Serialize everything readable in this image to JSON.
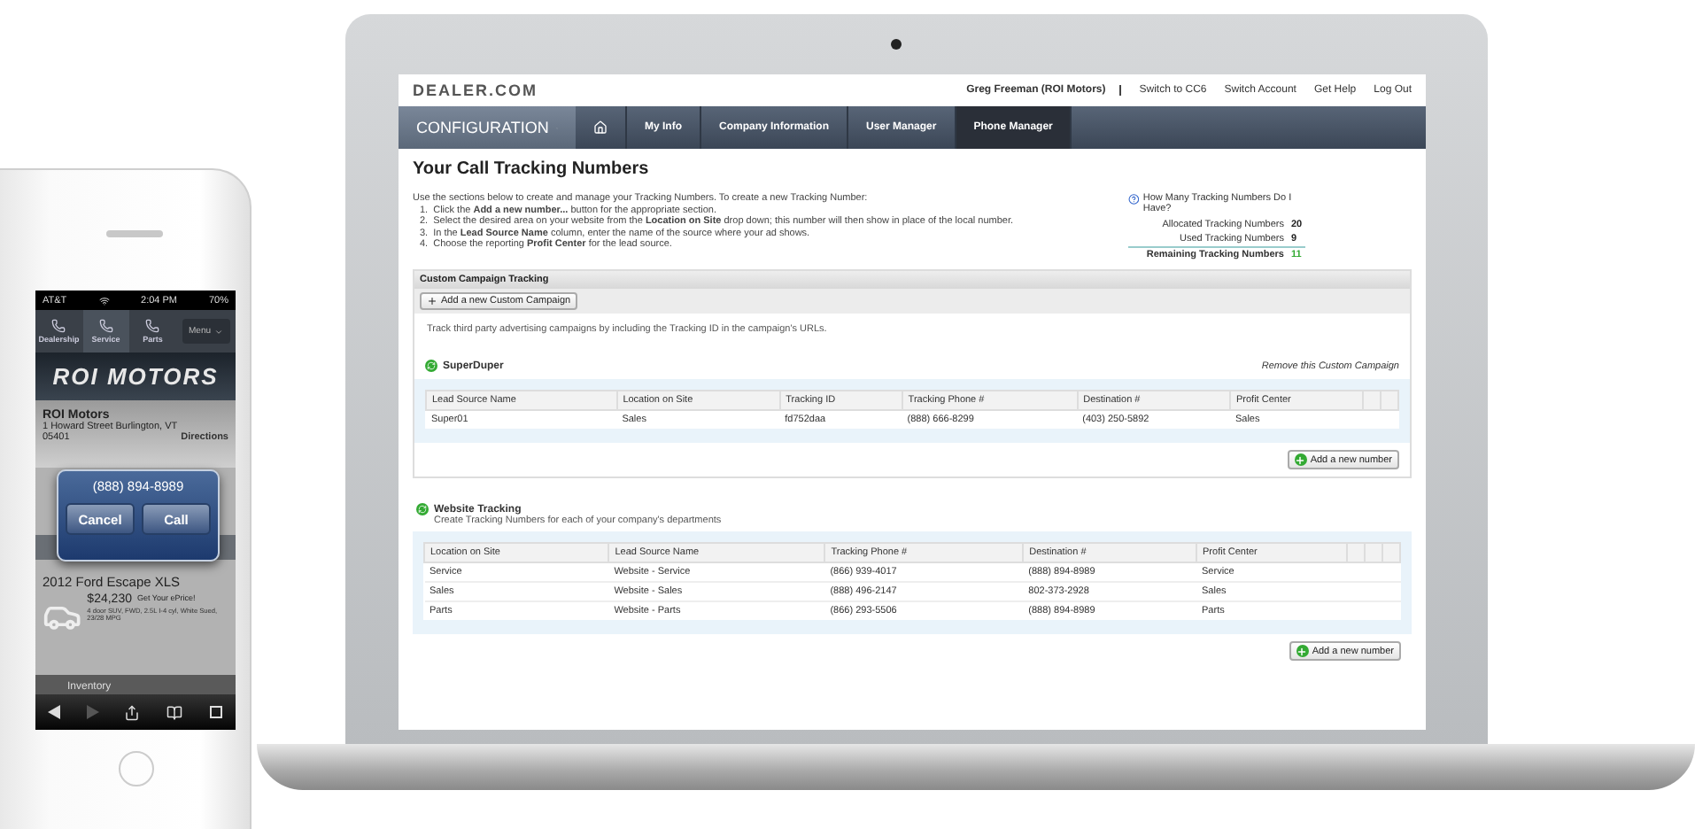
{
  "phone": {
    "status_bar": {
      "carrier": "AT&T",
      "time": "2:04 PM",
      "battery": "70%"
    },
    "nav": [
      {
        "label": "Dealership",
        "selected": false
      },
      {
        "label": "Service",
        "selected": true
      },
      {
        "label": "Parts",
        "selected": false
      }
    ],
    "menu": "Menu",
    "banner": "ROI MOTORS",
    "dealer": {
      "name": "ROI Motors",
      "address": "1 Howard Street Burlington, VT",
      "zip": "05401",
      "directions": "Directions"
    },
    "dialog": {
      "number": "(888) 894-8989",
      "buttons": [
        "Cancel",
        "Call"
      ]
    },
    "vehicle": {
      "title": "2012 Ford Escape XLS",
      "price": "$24,230",
      "cta": "Get Your ePrice!",
      "details": "4 door SUV, FWD, 2.5L I-4 cyl, White Sued, 23/28 MPG"
    },
    "section": "Inventory"
  },
  "laptop": {
    "logo": "DEALER.COM",
    "user": "Greg Freeman (ROI Motors)",
    "top_links": [
      "Switch to CC6",
      "Switch Account",
      "Get Help",
      "Log Out"
    ],
    "config_menu": "CONFIGURATION",
    "tabs": [
      {
        "label": "My Info",
        "selected": false
      },
      {
        "label": "Company Information",
        "selected": false
      },
      {
        "label": "User Manager",
        "selected": false
      },
      {
        "label": "Phone Manager",
        "selected": true
      }
    ],
    "title": "Your Call Tracking Numbers",
    "intro": "Use the sections below to create and manage your Tracking Numbers. To create a new Tracking Number:",
    "steps": [
      {
        "number": "1.",
        "text": "Click the **Add a new number...** button for the appropriate section."
      },
      {
        "number": "2.",
        "text": "Select the desired area on your website from the **Location on Site** drop down; this number will then show in place of the local number."
      },
      {
        "number": "3.",
        "text": "In the **Lead Source Name** column, enter the name of the source where your ad shows."
      },
      {
        "number": "4.",
        "text": "Choose the reporting **Profit Center** for the lead source."
      }
    ],
    "stats": {
      "question": "How Many Tracking Numbers Do I Have?",
      "items": [
        {
          "label": "Allocated Tracking Numbers",
          "value": "20",
          "kind": "count"
        },
        {
          "label": "Used Tracking Numbers",
          "value": "9",
          "kind": "count"
        },
        {
          "label": "Remaining Tracking Numbers",
          "value": "11",
          "kind": "total"
        }
      ]
    },
    "custom": {
      "header": "Custom Campaign Tracking",
      "add_button": "Add a new Custom Campaign",
      "description": "Track third party advertising campaigns by including the Tracking ID in the campaign's URLs.",
      "campaign": {
        "name": "SuperDuper",
        "remove": "Remove this Custom Campaign",
        "table": {
          "columns": [
            "Lead Source Name",
            "Location on Site",
            "Tracking ID",
            "Tracking Phone #",
            "Destination #",
            "Profit Center"
          ],
          "rows": [
            [
              "Super01",
              "Sales",
              "fd752daa",
              "(888) 666-8299",
              "(403) 250-5892",
              "Sales"
            ]
          ]
        },
        "add_number": "Add a new number"
      }
    },
    "website": {
      "title": "Website Tracking",
      "subtitle": "Create Tracking Numbers for each of your company's departments",
      "table": {
        "columns": [
          "Location on Site",
          "Lead Source Name",
          "Tracking Phone #",
          "Destination #",
          "Profit Center"
        ],
        "rows": [
          [
            "Service",
            "Website - Service",
            "(866) 939-4017",
            "(888) 894-8989",
            "Service"
          ],
          [
            "Sales",
            "Website - Sales",
            "(888) 496-2147",
            "802-373-2928",
            "Sales"
          ],
          [
            "Parts",
            "Website - Parts",
            "(866) 293-5506",
            "(888) 894-8989",
            "Parts"
          ]
        ]
      },
      "add_number": "Add a new number"
    }
  }
}
